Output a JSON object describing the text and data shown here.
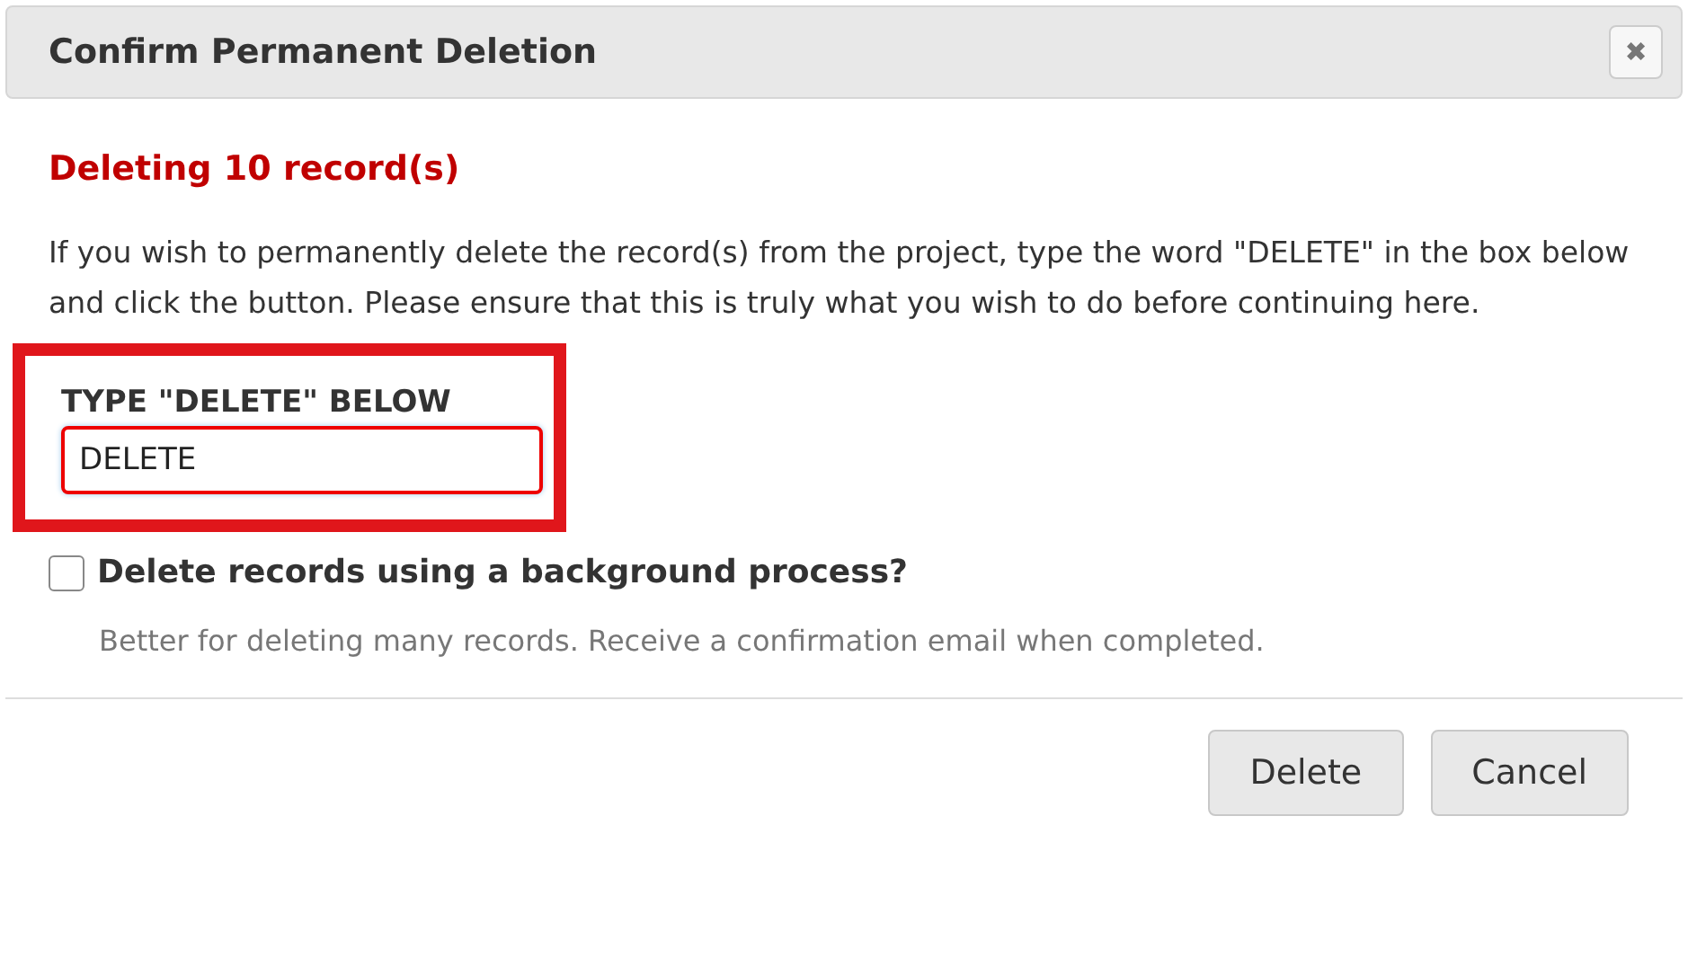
{
  "dialog": {
    "title": "Confirm Permanent Deletion",
    "close_label": "✖"
  },
  "heading": "Deleting 10 record(s)",
  "message": "If you wish to permanently delete the record(s) from the project, type the word \"DELETE\" in the box below and click the button. Please ensure that this is truly what you wish to do before continuing here.",
  "confirm_field": {
    "label": "TYPE \"DELETE\" BELOW",
    "value": "DELETE",
    "highlighted": true
  },
  "background_option": {
    "label": "Delete records using a background process?",
    "checked": false,
    "hint": "Better for deleting many records. Receive a confirmation email when completed."
  },
  "buttons": [
    {
      "label": "Delete"
    },
    {
      "label": "Cancel"
    }
  ]
}
